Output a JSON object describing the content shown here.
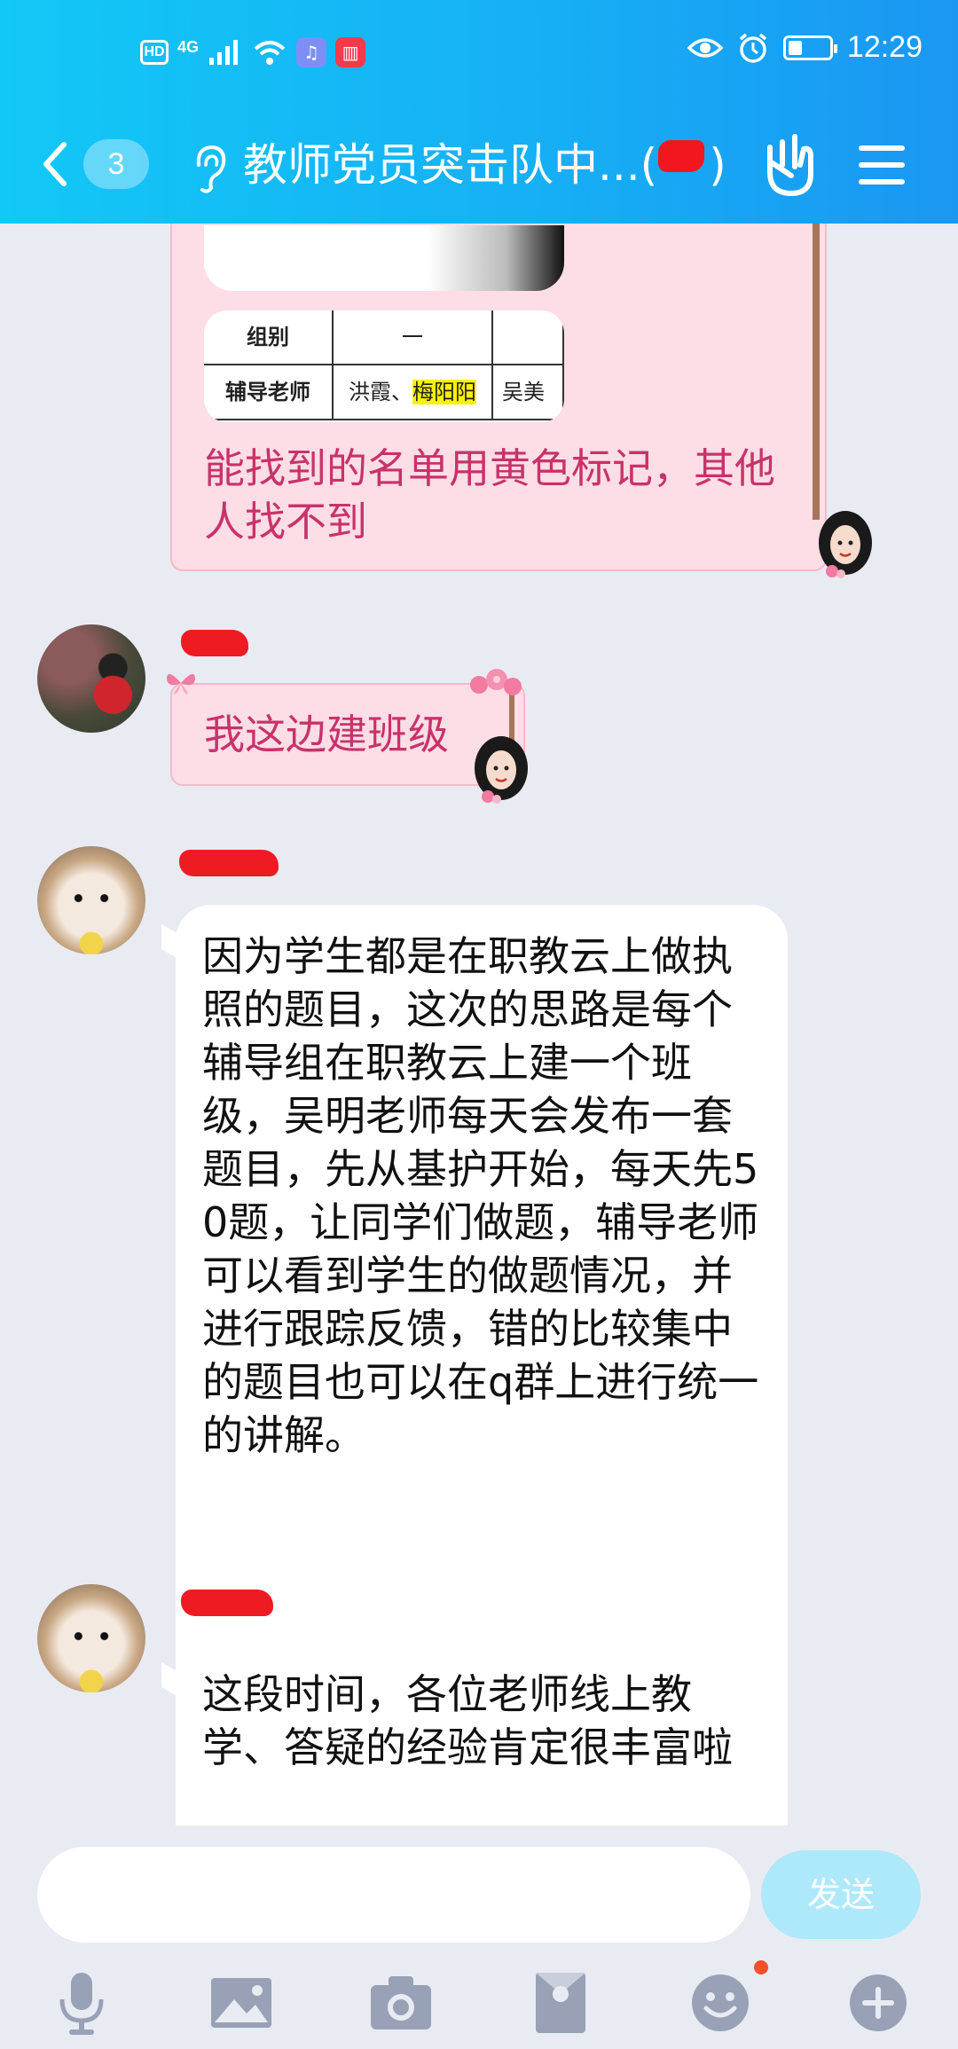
{
  "status_bar": {
    "hd": "HD",
    "network": "4G",
    "time": "12:29",
    "battery_level": 0.35
  },
  "nav": {
    "unread_count": "3",
    "title": "教师党员突击队中...(",
    "title_suffix": ")"
  },
  "messages": {
    "table_card": {
      "row1": [
        "组别",
        "一"
      ],
      "row2": [
        "辅导老师",
        "洪霞、",
        "梅阳阳",
        "吴美"
      ]
    },
    "msg1": "能找到的名单用黄色标记，其他人找不到",
    "msg2": "我这边建班级",
    "msg3": "因为学生都是在职教云上做执照的题目，这次的思路是每个辅导组在职教云上建一个班级，吴明老师每天会发布一套题目，先从基护开始，每天先50题，让同学们做题，辅导老师可以看到学生的做题情况，并进行跟踪反馈，错的比较集中的题目也可以在q群上进行统一的讲解。",
    "msg4": "这段时间，各位老师线上教学、答疑的经验肯定很丰富啦"
  },
  "input": {
    "placeholder": "",
    "send_label": "发送"
  },
  "colors": {
    "header_start": "#12c8f6",
    "header_end": "#1a97f2",
    "pink_bubble": "#fddde6",
    "pink_text": "#c8326a",
    "send_button": "#aee8fb",
    "redaction": "#ef1b23"
  },
  "icons": [
    "back-icon",
    "ear-icon",
    "gesture-icon",
    "menu-icon",
    "mic-icon",
    "image-icon",
    "camera-icon",
    "red-packet-icon",
    "emoji-icon",
    "plus-icon"
  ]
}
